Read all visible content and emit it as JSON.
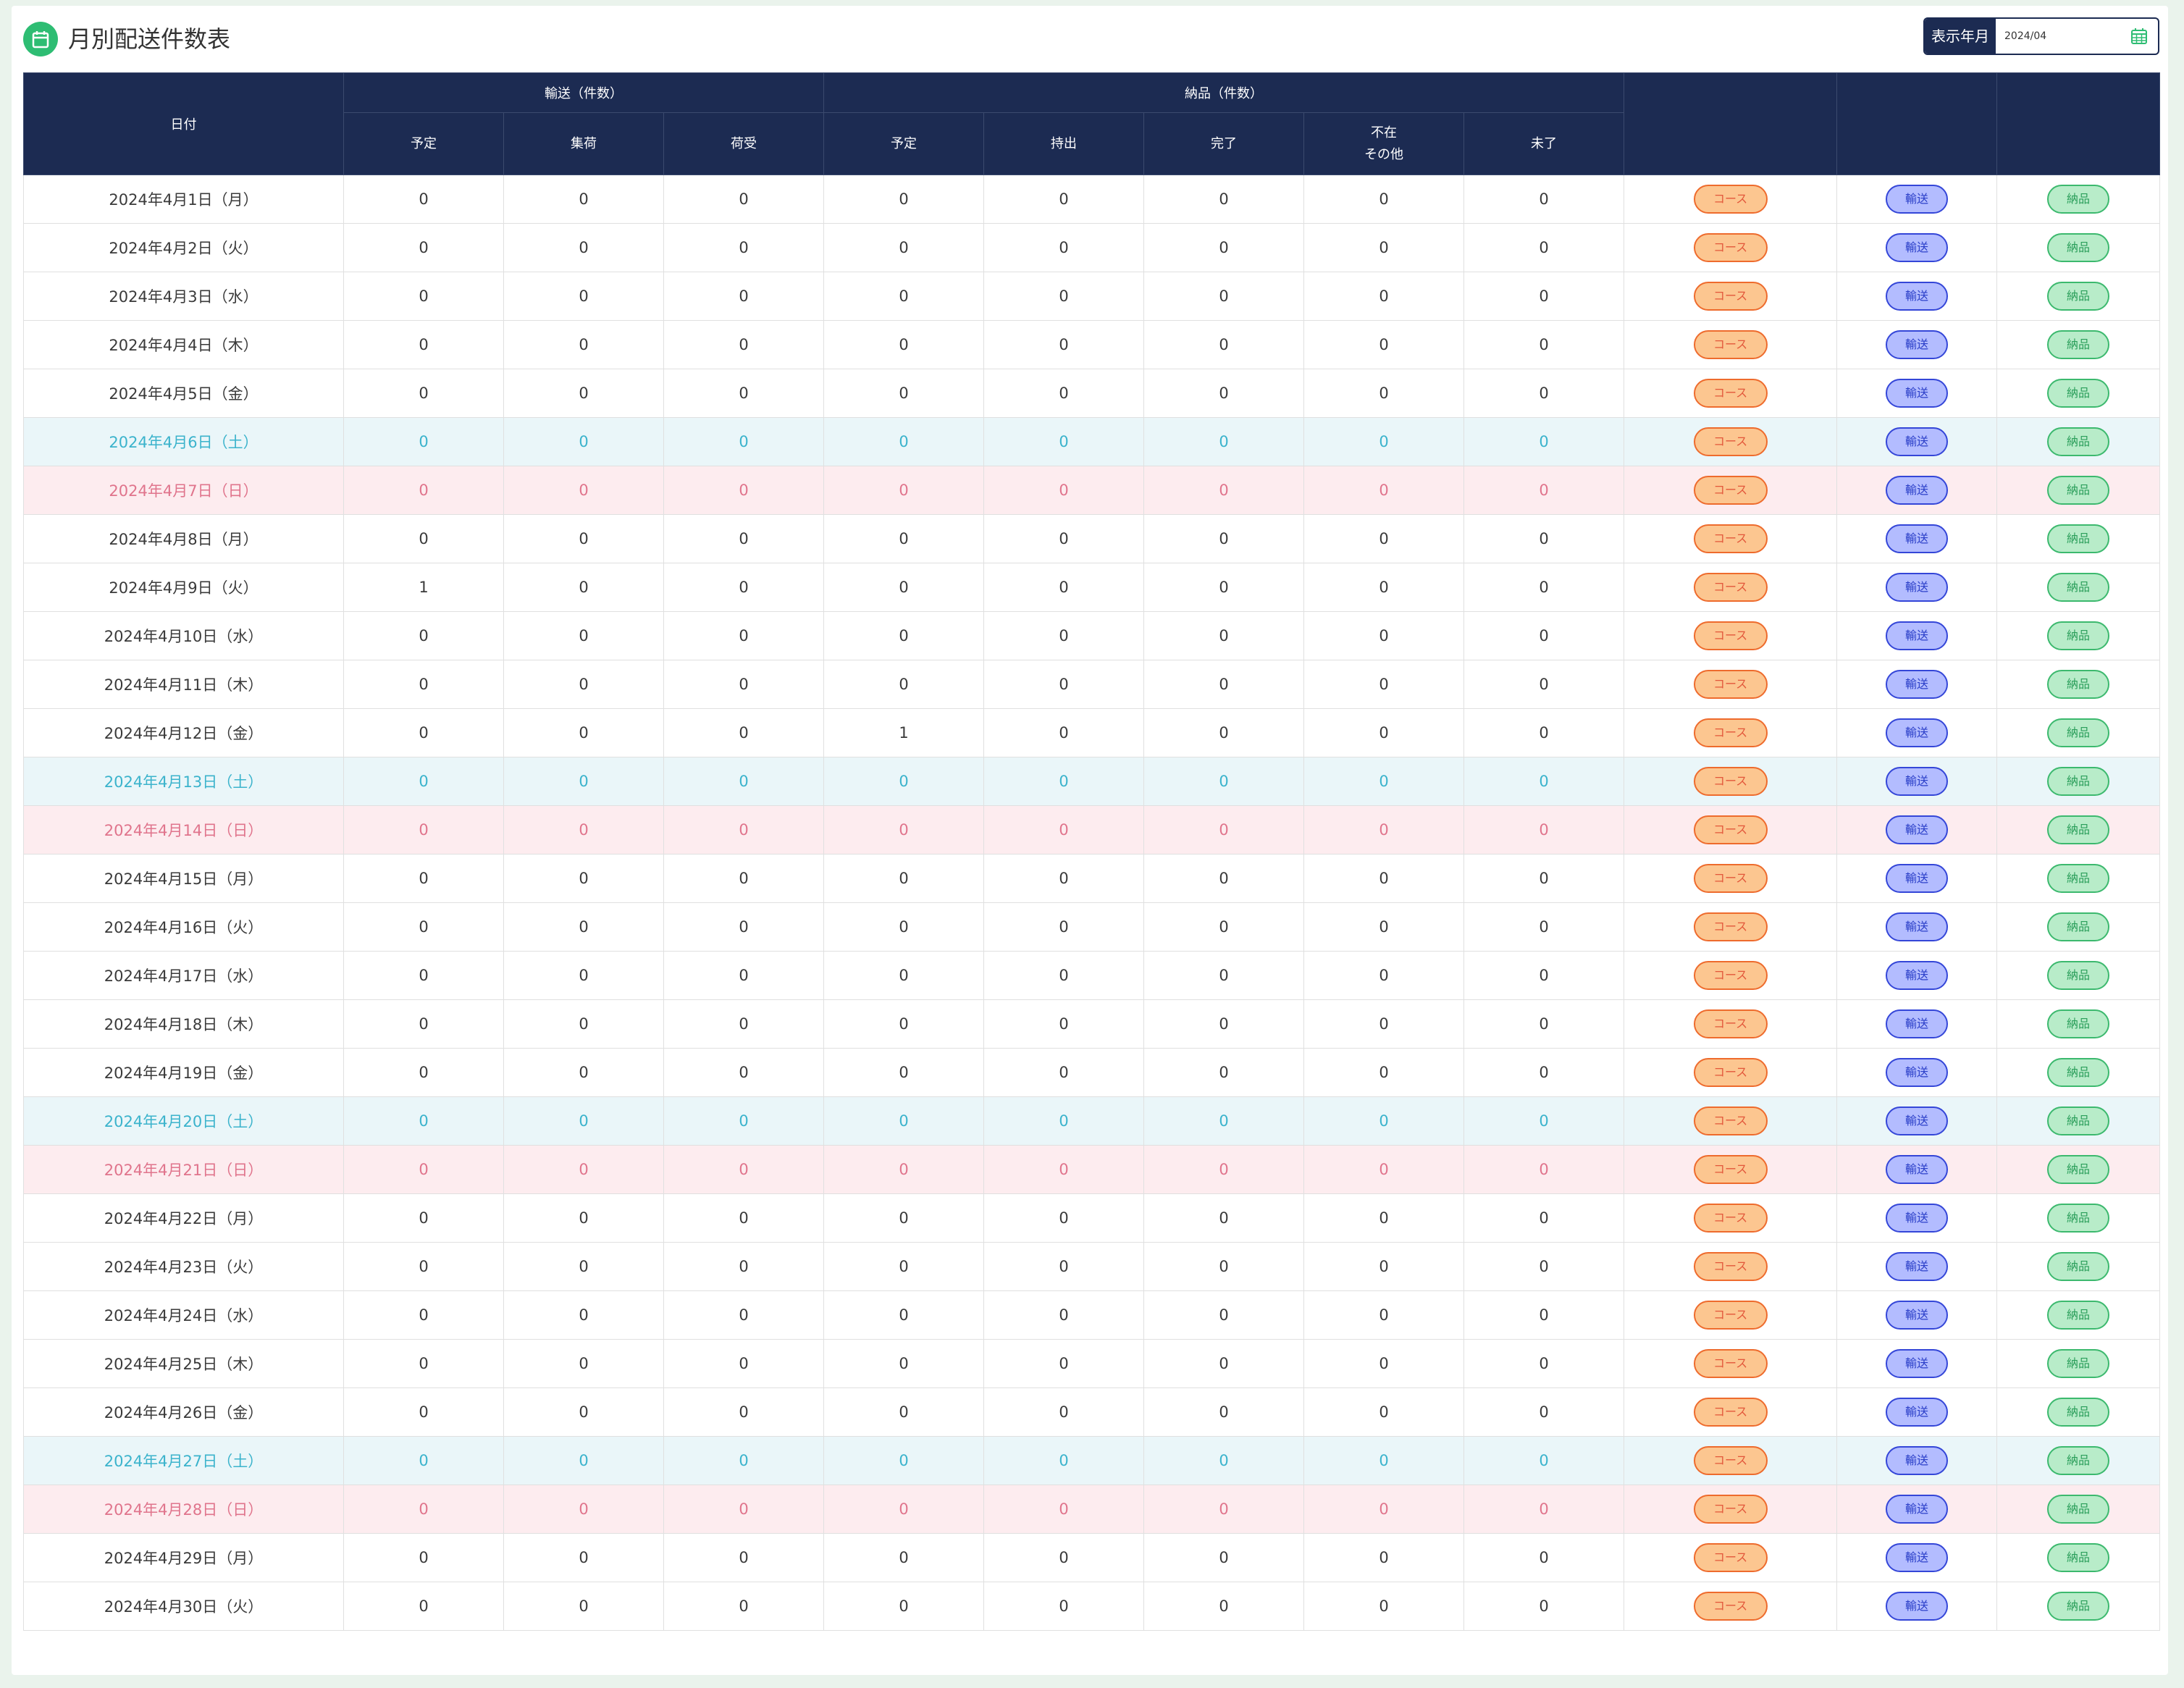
{
  "page": {
    "title": "月別配送件数表",
    "title_icon": "calendar-icon",
    "month_label": "表示年月",
    "month_value": "2024/04",
    "picker_icon": "calendar-grid-icon"
  },
  "table": {
    "date_header": "日付",
    "transport_group": "輸送（件数）",
    "delivery_group": "納品（件数）",
    "transport_cols": [
      "予定",
      "集荷",
      "荷受"
    ],
    "delivery_cols": [
      "予定",
      "持出",
      "完了",
      "不在\nその他",
      "未了"
    ],
    "button_labels": {
      "course": "コース",
      "transport": "輸送",
      "delivery": "納品"
    },
    "colors": {
      "header": "#1c2b52",
      "saturday_text": "#3bb3cc",
      "sunday_text": "#e0748c"
    },
    "rows": [
      {
        "date": "2024年4月1日（月）",
        "day": "weekday",
        "v": [
          0,
          0,
          0,
          0,
          0,
          0,
          0,
          0
        ]
      },
      {
        "date": "2024年4月2日（火）",
        "day": "weekday",
        "v": [
          0,
          0,
          0,
          0,
          0,
          0,
          0,
          0
        ]
      },
      {
        "date": "2024年4月3日（水）",
        "day": "weekday",
        "v": [
          0,
          0,
          0,
          0,
          0,
          0,
          0,
          0
        ]
      },
      {
        "date": "2024年4月4日（木）",
        "day": "weekday",
        "v": [
          0,
          0,
          0,
          0,
          0,
          0,
          0,
          0
        ]
      },
      {
        "date": "2024年4月5日（金）",
        "day": "weekday",
        "v": [
          0,
          0,
          0,
          0,
          0,
          0,
          0,
          0
        ]
      },
      {
        "date": "2024年4月6日（土）",
        "day": "sat",
        "v": [
          0,
          0,
          0,
          0,
          0,
          0,
          0,
          0
        ]
      },
      {
        "date": "2024年4月7日（日）",
        "day": "sun",
        "v": [
          0,
          0,
          0,
          0,
          0,
          0,
          0,
          0
        ]
      },
      {
        "date": "2024年4月8日（月）",
        "day": "weekday",
        "v": [
          0,
          0,
          0,
          0,
          0,
          0,
          0,
          0
        ]
      },
      {
        "date": "2024年4月9日（火）",
        "day": "weekday",
        "v": [
          1,
          0,
          0,
          0,
          0,
          0,
          0,
          0
        ]
      },
      {
        "date": "2024年4月10日（水）",
        "day": "weekday",
        "v": [
          0,
          0,
          0,
          0,
          0,
          0,
          0,
          0
        ]
      },
      {
        "date": "2024年4月11日（木）",
        "day": "weekday",
        "v": [
          0,
          0,
          0,
          0,
          0,
          0,
          0,
          0
        ]
      },
      {
        "date": "2024年4月12日（金）",
        "day": "weekday",
        "v": [
          0,
          0,
          0,
          1,
          0,
          0,
          0,
          0
        ]
      },
      {
        "date": "2024年4月13日（土）",
        "day": "sat",
        "v": [
          0,
          0,
          0,
          0,
          0,
          0,
          0,
          0
        ]
      },
      {
        "date": "2024年4月14日（日）",
        "day": "sun",
        "v": [
          0,
          0,
          0,
          0,
          0,
          0,
          0,
          0
        ]
      },
      {
        "date": "2024年4月15日（月）",
        "day": "weekday",
        "v": [
          0,
          0,
          0,
          0,
          0,
          0,
          0,
          0
        ]
      },
      {
        "date": "2024年4月16日（火）",
        "day": "weekday",
        "v": [
          0,
          0,
          0,
          0,
          0,
          0,
          0,
          0
        ]
      },
      {
        "date": "2024年4月17日（水）",
        "day": "weekday",
        "v": [
          0,
          0,
          0,
          0,
          0,
          0,
          0,
          0
        ]
      },
      {
        "date": "2024年4月18日（木）",
        "day": "weekday",
        "v": [
          0,
          0,
          0,
          0,
          0,
          0,
          0,
          0
        ]
      },
      {
        "date": "2024年4月19日（金）",
        "day": "weekday",
        "v": [
          0,
          0,
          0,
          0,
          0,
          0,
          0,
          0
        ]
      },
      {
        "date": "2024年4月20日（土）",
        "day": "sat",
        "v": [
          0,
          0,
          0,
          0,
          0,
          0,
          0,
          0
        ]
      },
      {
        "date": "2024年4月21日（日）",
        "day": "sun",
        "v": [
          0,
          0,
          0,
          0,
          0,
          0,
          0,
          0
        ]
      },
      {
        "date": "2024年4月22日（月）",
        "day": "weekday",
        "v": [
          0,
          0,
          0,
          0,
          0,
          0,
          0,
          0
        ]
      },
      {
        "date": "2024年4月23日（火）",
        "day": "weekday",
        "v": [
          0,
          0,
          0,
          0,
          0,
          0,
          0,
          0
        ]
      },
      {
        "date": "2024年4月24日（水）",
        "day": "weekday",
        "v": [
          0,
          0,
          0,
          0,
          0,
          0,
          0,
          0
        ]
      },
      {
        "date": "2024年4月25日（木）",
        "day": "weekday",
        "v": [
          0,
          0,
          0,
          0,
          0,
          0,
          0,
          0
        ]
      },
      {
        "date": "2024年4月26日（金）",
        "day": "weekday",
        "v": [
          0,
          0,
          0,
          0,
          0,
          0,
          0,
          0
        ]
      },
      {
        "date": "2024年4月27日（土）",
        "day": "sat",
        "v": [
          0,
          0,
          0,
          0,
          0,
          0,
          0,
          0
        ]
      },
      {
        "date": "2024年4月28日（日）",
        "day": "sun",
        "v": [
          0,
          0,
          0,
          0,
          0,
          0,
          0,
          0
        ]
      },
      {
        "date": "2024年4月29日（月）",
        "day": "weekday",
        "v": [
          0,
          0,
          0,
          0,
          0,
          0,
          0,
          0
        ]
      },
      {
        "date": "2024年4月30日（火）",
        "day": "weekday",
        "v": [
          0,
          0,
          0,
          0,
          0,
          0,
          0,
          0
        ]
      }
    ]
  }
}
